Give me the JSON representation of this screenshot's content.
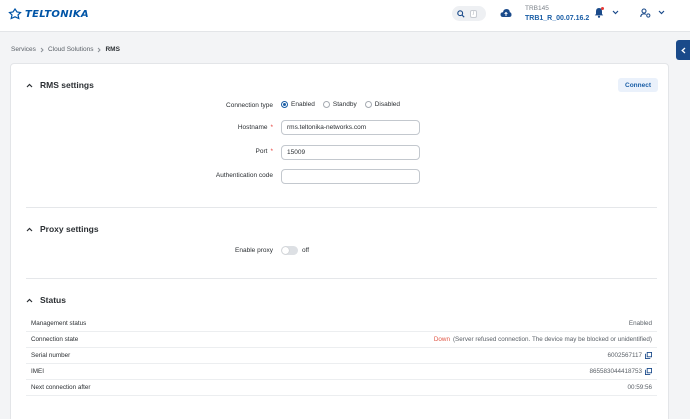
{
  "header": {
    "logo_text": "TELTONIKA",
    "search_shortcut": "/",
    "device_model": "TRB145",
    "firmware": "TRB1_R_00.07.16.2",
    "accent_color": "#0054a6"
  },
  "breadcrumb": {
    "items": [
      "Services",
      "Cloud Solutions"
    ],
    "current": "RMS"
  },
  "rms_settings": {
    "title": "RMS settings",
    "connect_label": "Connect",
    "connection_type_label": "Connection type",
    "connection_options": [
      "Enabled",
      "Standby",
      "Disabled"
    ],
    "connection_selected": "Enabled",
    "hostname_label": "Hostname",
    "hostname_value": "rms.teltonika-networks.com",
    "port_label": "Port",
    "port_value": "15009",
    "auth_code_label": "Authentication code",
    "auth_code_value": ""
  },
  "proxy_settings": {
    "title": "Proxy settings",
    "enable_label": "Enable proxy",
    "enable_state": "off"
  },
  "status": {
    "title": "Status",
    "management_status_label": "Management status",
    "management_status_value": "Enabled",
    "connection_state_label": "Connection state",
    "connection_state_value": "Down",
    "connection_state_note": "(Server refused connection. The device may be blocked or unidentified)",
    "serial_label": "Serial number",
    "serial_value": "6002567117",
    "imei_label": "IMEI",
    "imei_value": "865583044418753",
    "next_connection_label": "Next connection after",
    "next_connection_value": "00:59:56"
  },
  "icons": [
    "search-icon",
    "cloud-upload-icon",
    "bell-icon",
    "user-settings-icon",
    "chevron-down-icon",
    "chevron-right-icon",
    "chevron-up-icon",
    "copy-icon",
    "panel-toggle-icon"
  ]
}
